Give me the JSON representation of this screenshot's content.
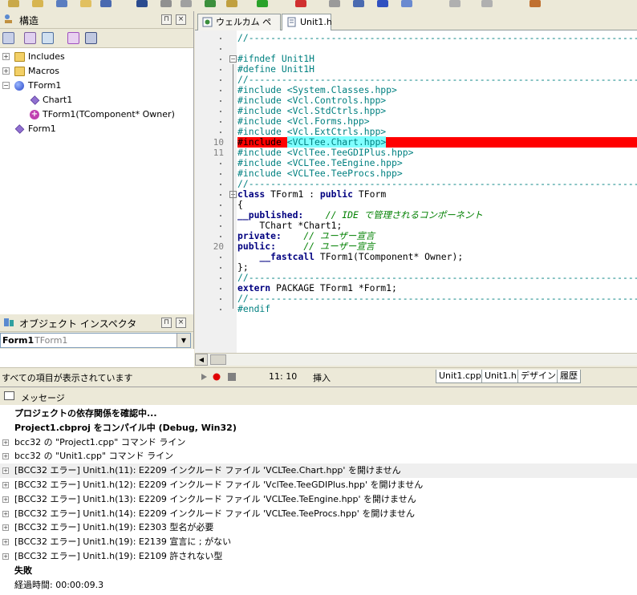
{
  "colors": {
    "accent_red": "#ff0000",
    "directive": "#008080",
    "comment": "#008000",
    "keyword": "#000080"
  },
  "structure_panel": {
    "title": "構造",
    "buttons": [
      "pin-icon",
      "close-icon"
    ],
    "tree": [
      {
        "label": "Includes",
        "icon": "folder-icon",
        "expander": "+"
      },
      {
        "label": "Macros",
        "icon": "folder-icon",
        "expander": "+"
      },
      {
        "label": "TForm1",
        "icon": "class-icon",
        "expander": "−"
      },
      {
        "label": "Chart1",
        "icon": "field-icon"
      },
      {
        "label": "TForm1(TComponent* Owner)",
        "icon": "method-icon"
      },
      {
        "label": "Form1",
        "icon": "field-icon"
      }
    ]
  },
  "object_inspector": {
    "title": "オブジェクト インスペクタ",
    "selected_name": "Form1",
    "selected_class": "TForm1"
  },
  "editor_tabs": [
    {
      "label": "ウェルカム ページ",
      "icon": "welcome-page-icon",
      "active": false
    },
    {
      "label": "Unit1.h",
      "icon": "header-file-icon",
      "active": true
    }
  ],
  "editor": {
    "line_numbers": [
      {
        "row": 10,
        "label": "10"
      },
      {
        "row": 11,
        "label": "11"
      },
      {
        "row": 20,
        "label": "20"
      }
    ],
    "lines": [
      {
        "row": 0,
        "parts": [
          {
            "t": "//---------------------------------------------------------------------------",
            "c": "dir"
          }
        ]
      },
      {
        "row": 2,
        "parts": [
          {
            "t": "#ifndef Unit1H",
            "c": "dir"
          }
        ]
      },
      {
        "row": 3,
        "parts": [
          {
            "t": "#define Unit1H",
            "c": "dir"
          }
        ]
      },
      {
        "row": 4,
        "parts": [
          {
            "t": "//---------------------------------------------------------------------------",
            "c": "dir"
          }
        ]
      },
      {
        "row": 5,
        "parts": [
          {
            "t": "#include <System.Classes.hpp>",
            "c": "dir"
          }
        ]
      },
      {
        "row": 6,
        "parts": [
          {
            "t": "#include <Vcl.Controls.hpp>",
            "c": "dir"
          }
        ]
      },
      {
        "row": 7,
        "parts": [
          {
            "t": "#include <Vcl.StdCtrls.hpp>",
            "c": "dir"
          }
        ]
      },
      {
        "row": 8,
        "parts": [
          {
            "t": "#include <Vcl.Forms.hpp>",
            "c": "dir"
          }
        ]
      },
      {
        "row": 9,
        "parts": [
          {
            "t": "#include <Vcl.ExtCtrls.hpp>",
            "c": "dir"
          }
        ]
      },
      {
        "row": 10,
        "highlight": true,
        "parts": [
          {
            "t": "#include ",
            "c": "txt"
          },
          {
            "t": "<VCLTee.Chart.hpp>",
            "c": "hlsel"
          }
        ]
      },
      {
        "row": 11,
        "parts": [
          {
            "t": "#include <VclTee.TeeGDIPlus.hpp>",
            "c": "dir"
          }
        ]
      },
      {
        "row": 12,
        "parts": [
          {
            "t": "#include <VCLTee.TeEngine.hpp>",
            "c": "dir"
          }
        ]
      },
      {
        "row": 13,
        "parts": [
          {
            "t": "#include <VCLTee.TeeProcs.hpp>",
            "c": "dir"
          }
        ]
      },
      {
        "row": 14,
        "parts": [
          {
            "t": "//---------------------------------------------------------------------------",
            "c": "dir"
          }
        ]
      },
      {
        "row": 15,
        "parts": [
          {
            "t": "class",
            "c": "key"
          },
          {
            "t": " TForm1 : ",
            "c": "txt"
          },
          {
            "t": "public",
            "c": "key"
          },
          {
            "t": " TForm",
            "c": "txt"
          }
        ]
      },
      {
        "row": 16,
        "parts": [
          {
            "t": "{",
            "c": "txt"
          }
        ]
      },
      {
        "row": 17,
        "parts": [
          {
            "t": "__published:",
            "c": "key"
          },
          {
            "t": "    ",
            "c": "txt"
          },
          {
            "t": "// IDE で管理されるコンポーネント",
            "c": "cmt"
          }
        ]
      },
      {
        "row": 18,
        "parts": [
          {
            "t": "    TChart *Chart1;",
            "c": "txt"
          }
        ]
      },
      {
        "row": 19,
        "parts": [
          {
            "t": "private:",
            "c": "key"
          },
          {
            "t": "    ",
            "c": "txt"
          },
          {
            "t": "// ユーザー宣言",
            "c": "cmt"
          }
        ]
      },
      {
        "row": 20,
        "parts": [
          {
            "t": "public:",
            "c": "key"
          },
          {
            "t": "     ",
            "c": "txt"
          },
          {
            "t": "// ユーザー宣言",
            "c": "cmt"
          }
        ]
      },
      {
        "row": 21,
        "parts": [
          {
            "t": "    ",
            "c": "txt"
          },
          {
            "t": "__fastcall",
            "c": "key"
          },
          {
            "t": " TForm1(TComponent* Owner);",
            "c": "txt"
          }
        ]
      },
      {
        "row": 22,
        "parts": [
          {
            "t": "};",
            "c": "txt"
          }
        ]
      },
      {
        "row": 23,
        "parts": [
          {
            "t": "//---------------------------------------------------------------------------",
            "c": "dir"
          }
        ]
      },
      {
        "row": 24,
        "parts": [
          {
            "t": "extern",
            "c": "key"
          },
          {
            "t": " PACKAGE TForm1 *Form1;",
            "c": "txt"
          }
        ]
      },
      {
        "row": 25,
        "parts": [
          {
            "t": "//---------------------------------------------------------------------------",
            "c": "dir"
          }
        ]
      },
      {
        "row": 26,
        "parts": [
          {
            "t": "#endif",
            "c": "dir"
          }
        ]
      }
    ]
  },
  "status_bar": {
    "text": "すべての項目が表示されています",
    "cursor_pos": "11:  10",
    "mode": "挿入",
    "bottom_tabs": [
      "Unit1.cpp",
      "Unit1.h",
      "デザイン",
      "履歴"
    ]
  },
  "messages": {
    "title": "メッセージ",
    "items": [
      {
        "text": "プロジェクトの依存関係を確認中...",
        "bold": true,
        "expander": false
      },
      {
        "text": "Project1.cbproj をコンパイル中 (Debug, Win32)",
        "bold": true,
        "expander": false
      },
      {
        "text": "bcc32 の \"Project1.cpp\" コマンド ライン",
        "bold": false,
        "expander": true
      },
      {
        "text": "bcc32 の \"Unit1.cpp\" コマンド ライン",
        "bold": false,
        "expander": true
      },
      {
        "text": "[BCC32 エラー] Unit1.h(11): E2209 インクルード ファイル 'VCLTee.Chart.hpp' を開けません",
        "bold": false,
        "expander": true,
        "selected": true
      },
      {
        "text": "[BCC32 エラー] Unit1.h(12): E2209 インクルード ファイル 'VclTee.TeeGDIPlus.hpp' を開けません",
        "bold": false,
        "expander": true
      },
      {
        "text": "[BCC32 エラー] Unit1.h(13): E2209 インクルード ファイル 'VCLTee.TeEngine.hpp' を開けません",
        "bold": false,
        "expander": true
      },
      {
        "text": "[BCC32 エラー] Unit1.h(14): E2209 インクルード ファイル 'VCLTee.TeeProcs.hpp' を開けません",
        "bold": false,
        "expander": true
      },
      {
        "text": "[BCC32 エラー] Unit1.h(19): E2303 型名が必要",
        "bold": false,
        "expander": true
      },
      {
        "text": "[BCC32 エラー] Unit1.h(19): E2139 宣言に ; がない",
        "bold": false,
        "expander": true
      },
      {
        "text": "[BCC32 エラー] Unit1.h(19): E2109 許されない型",
        "bold": false,
        "expander": true
      },
      {
        "text": "失敗",
        "bold": true,
        "expander": false
      },
      {
        "text": "経過時間: 00:00:09.3",
        "bold": false,
        "expander": false
      }
    ]
  }
}
